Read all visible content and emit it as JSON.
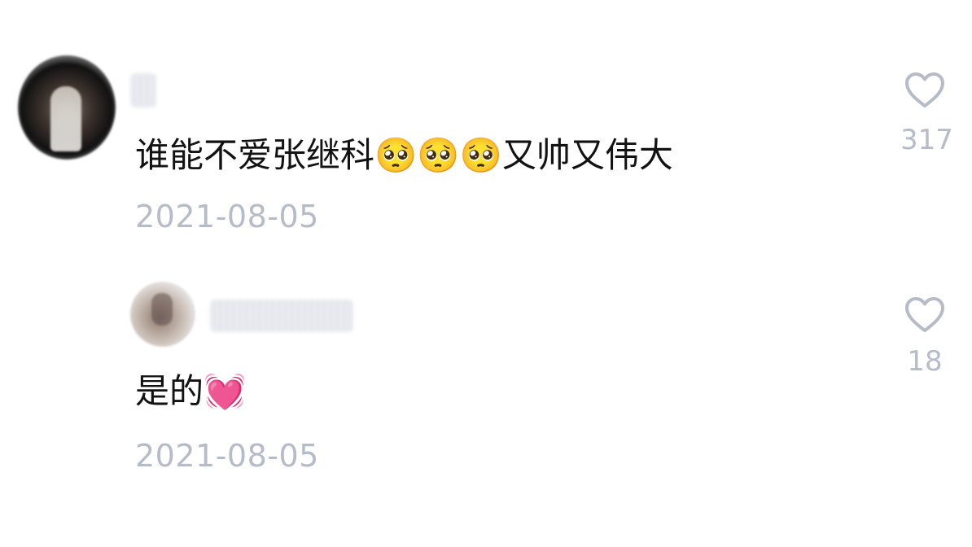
{
  "comments": [
    {
      "author": "",
      "text": "谁能不爱张继科🥺🥺🥺又帅又伟大",
      "date": "2021-08-05",
      "likes": "317"
    },
    {
      "author": "",
      "text": "是的💓",
      "date": "2021-08-05",
      "likes": "18"
    }
  ],
  "icons": {
    "like": "heart-outline-icon"
  },
  "colors": {
    "text": "#121212",
    "muted": "#b6bbc8",
    "background": "#ffffff"
  }
}
